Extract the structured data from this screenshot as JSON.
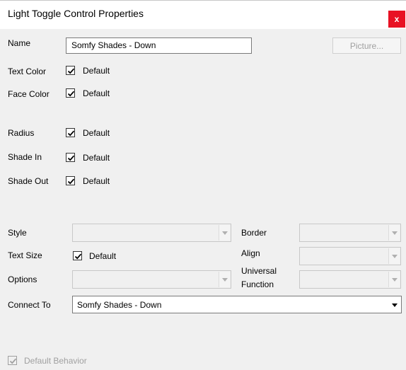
{
  "window": {
    "title": "Light Toggle Control Properties",
    "close_glyph": "x"
  },
  "name_field": {
    "label": "Name",
    "value": "Somfy Shades - Down"
  },
  "picture_button": {
    "label": "Picture..."
  },
  "colors": {
    "text_color": {
      "label": "Text Color",
      "checkbox_label": "Default",
      "checked": true
    },
    "face_color": {
      "label": "Face Color",
      "checkbox_label": "Default",
      "checked": true
    }
  },
  "shape": {
    "radius": {
      "label": "Radius",
      "checkbox_label": "Default",
      "checked": true
    },
    "shade_in": {
      "label": "Shade In",
      "checkbox_label": "Default",
      "checked": true
    },
    "shade_out": {
      "label": "Shade Out",
      "checkbox_label": "Default",
      "checked": true
    }
  },
  "style": {
    "label": "Style",
    "value": ""
  },
  "border": {
    "label": "Border",
    "value": ""
  },
  "text_size": {
    "label": "Text Size",
    "checkbox_label": "Default",
    "checked": true
  },
  "align": {
    "label": "Align",
    "value": ""
  },
  "options": {
    "label": "Options",
    "value": ""
  },
  "universal_function": {
    "label_line1": "Universal",
    "label_line2": "Function",
    "value": ""
  },
  "connect_to": {
    "label": "Connect To",
    "value": "Somfy Shades - Down"
  },
  "default_behavior": {
    "label": "Default Behavior",
    "checked": true,
    "enabled": false
  },
  "theme": {
    "close_bg": "#e81123",
    "dialog_bg": "#f0f0f0",
    "disabled_text": "#a0a0a0"
  }
}
